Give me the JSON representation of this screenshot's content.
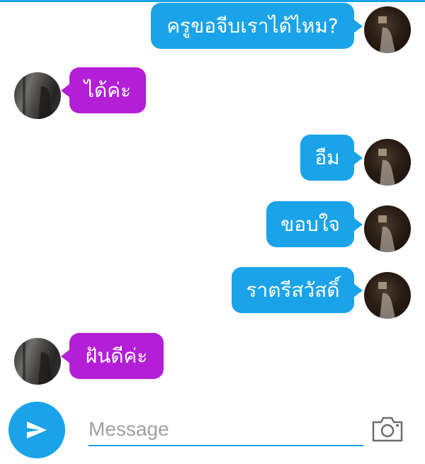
{
  "colors": {
    "accent": "#1aa3e8",
    "incoming_bubble": "#b31ed6",
    "text_on_bubble": "#ffffff"
  },
  "messages": [
    {
      "sender": "me",
      "text": "ครูขอจีบเราได้ไหม?"
    },
    {
      "sender": "them",
      "text": "ได้ค่ะ"
    },
    {
      "sender": "me",
      "text": "อืม"
    },
    {
      "sender": "me",
      "text": "ขอบใจ"
    },
    {
      "sender": "me",
      "text": "ราตรีสวัสดิ์"
    },
    {
      "sender": "them",
      "text": "ฝันดีค่ะ"
    }
  ],
  "composer": {
    "placeholder": "Message",
    "value": "",
    "send_icon": "send-icon",
    "camera_icon": "camera-icon"
  }
}
